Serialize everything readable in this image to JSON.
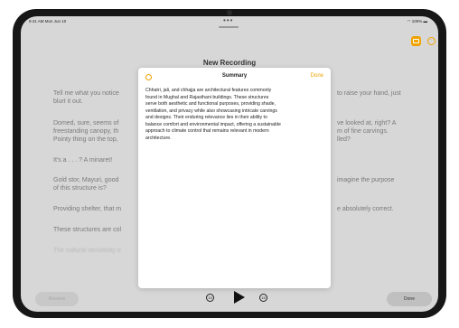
{
  "status_bar": {
    "time": "9:41 AM  Mon Jun 10",
    "battery": "100%"
  },
  "top_dots": "•••",
  "recording": {
    "title": "New Recording"
  },
  "transcript_lines": [
    "Tell me what you notice",
    "blurt it out.",
    "Domed, sure, seems of",
    "freestanding canopy, th",
    "Pointy thing on the top,",
    "It's a . . . ? A minaret!",
    "Gold stor, Mayuri, good",
    "of this structure is?",
    "Providing shelter, that m",
    "These structures are col",
    "The cultural sensitivity o"
  ],
  "transcript_right": [
    "to raise your hand, just",
    "ve looked at, right? A",
    "m of fine carvings.",
    "lled?",
    "imagine the purpose",
    "e absolutely correct."
  ],
  "summary": {
    "title": "Summary",
    "done_label": "Done",
    "lines": [
      "Chhatri, jali, and chhajja are architectural features commonly",
      "found in Mughal and Rajasthani buildings. These structures",
      "serve both aesthetic and functional purposes, providing shade,",
      "ventilation, and privacy while also showcasing intricate carvings",
      "and designs. Their enduring relevance lies in their ability to",
      "balance comfort and environmental impact, offering a sustainable",
      "approach to climate control that remains relevant in modern",
      "architecture."
    ]
  },
  "controls": {
    "resume_label": "Resume",
    "done_label": "Done",
    "skip_back": "15",
    "skip_forward": "15"
  },
  "colors": {
    "accent": "#f0a300"
  }
}
